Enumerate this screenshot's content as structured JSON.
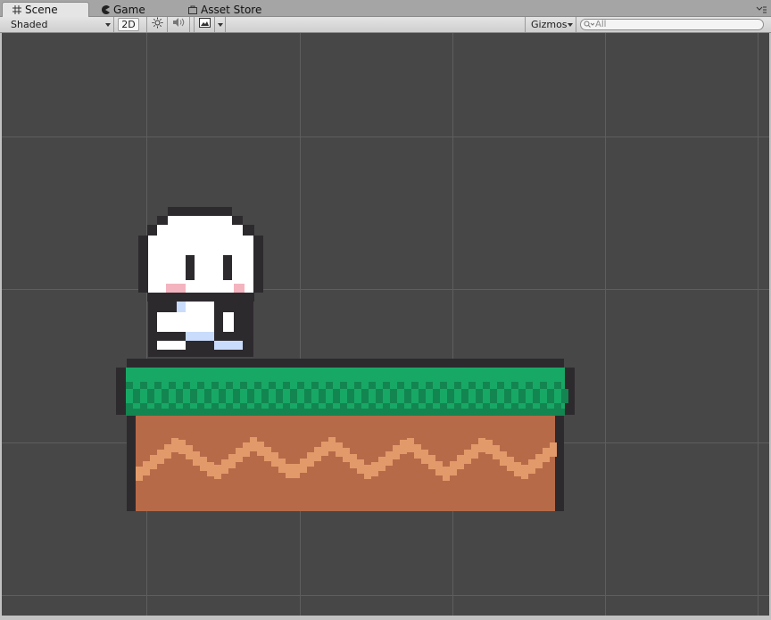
{
  "tabs": [
    {
      "label": "Scene",
      "icon": "grid-icon",
      "active": true
    },
    {
      "label": "Game",
      "icon": "pacman-icon",
      "active": false
    },
    {
      "label": "Asset Store",
      "icon": "bag-icon",
      "active": false
    }
  ],
  "toolbar": {
    "shading_mode": "Shaded",
    "mode_2d": "2D",
    "gizmos_label": "Gizmos",
    "search_placeholder": "All"
  },
  "scene": {
    "background_color": "#474747",
    "grid_color": "#5e5e5e",
    "objects": [
      "pixel-character",
      "grass-dirt-platform"
    ]
  },
  "colors": {
    "grass_light": "#18a866",
    "grass_dark": "#138550",
    "dirt_dark": "#b76a48",
    "dirt_light": "#e39a6a",
    "outline": "#2d2a2e",
    "character_body": "#ffffff",
    "character_blush": "#f3b4bf",
    "character_feet": "#c9dcfb"
  }
}
